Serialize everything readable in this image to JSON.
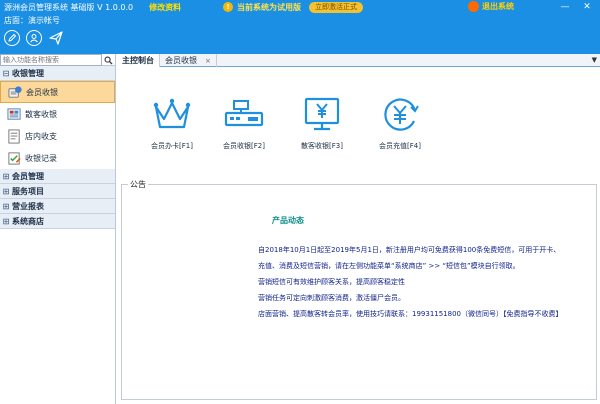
{
  "window": {
    "title": "源洲会员管理系统 基础版 V 1.0.0.0",
    "edit_link": "修改资料",
    "notice": "当前系统为试用版",
    "activate": "立即激活正式",
    "exit": "退出系统",
    "minimize": "—",
    "close": "✕"
  },
  "header": {
    "store_label": "店面：演示帐号"
  },
  "sidebar": {
    "search_placeholder": "输入功能名称搜索",
    "groups": [
      {
        "label": "收银管理"
      },
      {
        "label": "会员管理"
      },
      {
        "label": "服务项目"
      },
      {
        "label": "营业报表"
      },
      {
        "label": "系统商店"
      }
    ],
    "items": [
      {
        "label": "会员收银"
      },
      {
        "label": "散客收银"
      },
      {
        "label": "店内收支"
      },
      {
        "label": "收银记录"
      }
    ]
  },
  "tabs": [
    {
      "label": "主控制台"
    },
    {
      "label": "会员收银",
      "close": "×"
    }
  ],
  "tab_dropdown": "▼",
  "quick_actions": [
    {
      "label": "会员办卡[F1]",
      "icon": "crown-icon"
    },
    {
      "label": "会员收银[F2]",
      "icon": "cash-register-icon"
    },
    {
      "label": "散客收银[F3]",
      "icon": "monitor-yen-icon"
    },
    {
      "label": "会员充值[F4]",
      "icon": "yen-recharge-icon"
    }
  ],
  "announcement": {
    "legend": "公告",
    "title": "产品动态",
    "lines": [
      "自2018年10月1日起至2019年5月1日，新注册用户均可免费获得100条免费短信，可用于开卡、",
      "充值、消费及短信营销，请在左侧功能菜单“系统商店” >> “短信包”模块自行领取。",
      "营销短信可有效维护顾客关系，提高顾客稳定性",
      "营销任务可定向刺激顾客消费，激活僵尸会员。",
      "店面营销、提高散客转会员率，使用技巧请联系：19931151800（微信同号）【免费指导不收费】"
    ]
  },
  "colors": {
    "header_blue": "#1a8fe3",
    "active_item": "#fcd89a",
    "icon_blue": "#1f8fe0",
    "title_teal": "#0d8d8b",
    "text_navy": "#0e1e8c"
  }
}
